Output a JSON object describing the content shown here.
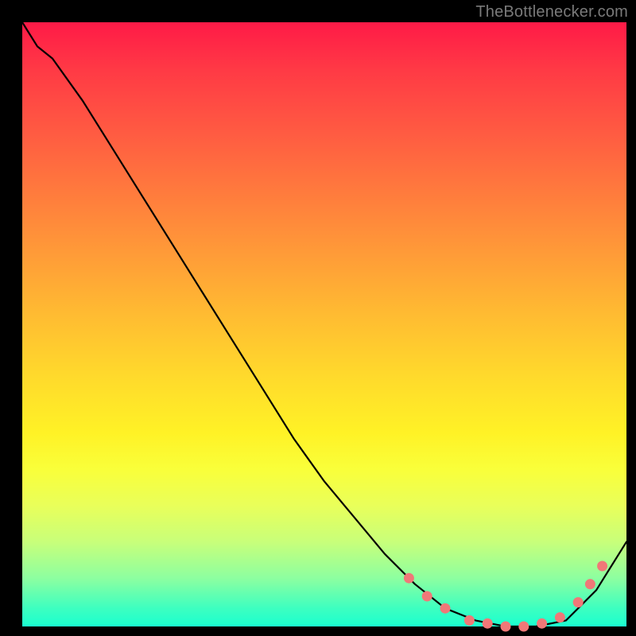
{
  "source_label": "TheBottlenecker.com",
  "chart_data": {
    "type": "line",
    "title": "",
    "xlabel": "",
    "ylabel": "",
    "xlim": [
      0,
      100
    ],
    "ylim": [
      0,
      100
    ],
    "x": [
      0,
      5,
      10,
      15,
      20,
      25,
      30,
      35,
      40,
      45,
      50,
      55,
      60,
      65,
      70,
      75,
      80,
      85,
      90,
      95,
      100
    ],
    "values": [
      100,
      94,
      87,
      79,
      71,
      63,
      55,
      47,
      39,
      31,
      24,
      18,
      12,
      7,
      3,
      1,
      0,
      0,
      1,
      6,
      14
    ],
    "markers_x": [
      64,
      67,
      70,
      74,
      77,
      80,
      83,
      86,
      89,
      92,
      94,
      96
    ],
    "markers_y": [
      8,
      5,
      3,
      1,
      0.5,
      0,
      0,
      0.5,
      1.5,
      4,
      7,
      10
    ],
    "annotations": []
  }
}
